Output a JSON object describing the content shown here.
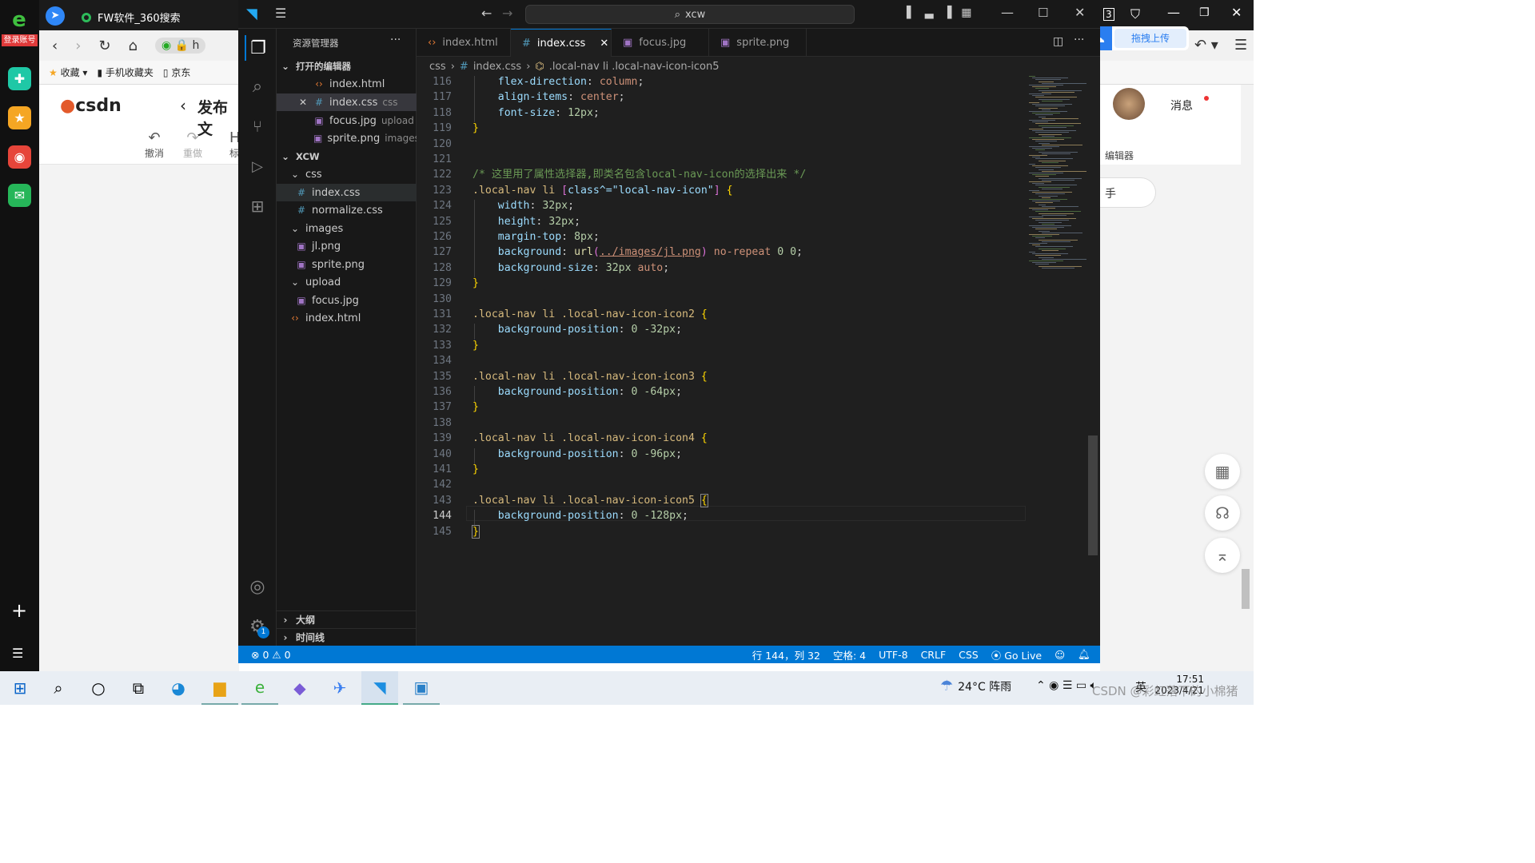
{
  "left_sidebar": {
    "login_label": "登录账号"
  },
  "browser": {
    "tab_title": "FW软件_360搜索",
    "url_partial": "h",
    "bookmarks": [
      "收藏",
      "手机收藏夹",
      "京东"
    ],
    "csdn_logo": "csdn",
    "page_title": "发布文",
    "undo_label": "撤消",
    "redo_label": "重做",
    "truncated_label": "标",
    "right_msg": "消息",
    "right_editor": "编辑器",
    "right_hand": "手",
    "right_top_num": "3"
  },
  "baidu_upload": {
    "label": "拖拽上传"
  },
  "vscode": {
    "search_text": "xcw",
    "explorer_title": "资源管理器",
    "open_editors_label": "打开的编辑器",
    "open_editors": [
      {
        "name": "index.html",
        "hint": "",
        "type": "html"
      },
      {
        "name": "index.css",
        "hint": "css",
        "type": "css"
      },
      {
        "name": "focus.jpg",
        "hint": "upload",
        "type": "img"
      },
      {
        "name": "sprite.png",
        "hint": "images",
        "type": "img"
      }
    ],
    "project_label": "XCW",
    "tree": [
      {
        "name": "css",
        "type": "folder",
        "level": 1
      },
      {
        "name": "index.css",
        "type": "css",
        "level": 2
      },
      {
        "name": "normalize.css",
        "type": "css",
        "level": 2
      },
      {
        "name": "images",
        "type": "folder",
        "level": 1
      },
      {
        "name": "jl.png",
        "type": "img",
        "level": 2
      },
      {
        "name": "sprite.png",
        "type": "img",
        "level": 2
      },
      {
        "name": "upload",
        "type": "folder",
        "level": 1
      },
      {
        "name": "focus.jpg",
        "type": "img",
        "level": 2
      },
      {
        "name": "index.html",
        "type": "html",
        "level": 1
      }
    ],
    "outline_label": "大纲",
    "timeline_label": "时间线",
    "tabs": [
      {
        "label": "index.html",
        "type": "html"
      },
      {
        "label": "index.css",
        "type": "css"
      },
      {
        "label": "focus.jpg",
        "type": "img"
      },
      {
        "label": "sprite.png",
        "type": "img"
      }
    ],
    "breadcrumb": {
      "folder": "css",
      "file": "index.css",
      "symbol": ".local-nav li .local-nav-icon-icon5"
    },
    "line_numbers": [
      "116",
      "117",
      "118",
      "119",
      "120",
      "121",
      "122",
      "123",
      "124",
      "125",
      "126",
      "127",
      "128",
      "129",
      "130",
      "131",
      "132",
      "133",
      "134",
      "135",
      "136",
      "137",
      "138",
      "139",
      "140",
      "141",
      "142",
      "143",
      "144",
      "145"
    ],
    "code": {
      "l116a": "flex-direction",
      "l116b": "column",
      "l117a": "align-items",
      "l117b": "center",
      "l118a": "font-size",
      "l118b": "12px",
      "l122": "/* 这里用了属性选择器,即类名包含local-nav-icon的选择出来 */",
      "l123a": ".local-nav li ",
      "l123b": "class^=\"local-nav-icon\"",
      "l124a": "width",
      "l124b": "32px",
      "l125a": "height",
      "l125b": "32px",
      "l126a": "margin-top",
      "l126b": "8px",
      "l127a": "background",
      "l127b": "url",
      "l127c": "../images/jl.png",
      "l127d": "no-repeat",
      "l127e": "0 0",
      "l128a": "background-size",
      "l128b": "32px",
      "l128c": "auto",
      "l131": ".local-nav li .local-nav-icon-icon2",
      "l132a": "background-position",
      "l132b": "0 -32px",
      "l135": ".local-nav li .local-nav-icon-icon3",
      "l136a": "background-position",
      "l136b": "0 -64px",
      "l139": ".local-nav li .local-nav-icon-icon4",
      "l140a": "background-position",
      "l140b": "0 -96px",
      "l143": ".local-nav li .local-nav-icon-icon5",
      "l144a": "background-position",
      "l144b": "0 -128px"
    },
    "status": {
      "errors": "0",
      "warnings": "0",
      "position": "行 144，列 32",
      "spaces": "空格: 4",
      "encoding": "UTF-8",
      "eol": "CRLF",
      "lang": "CSS",
      "golive": "Go Live"
    },
    "settings_badge": "1"
  },
  "taskbar": {
    "weather": "24°C 阵雨",
    "ime": "英",
    "time": "17:51",
    "date": "2023/4/21",
    "watermark": "CSDN @彩虹落下的小棉猪"
  }
}
